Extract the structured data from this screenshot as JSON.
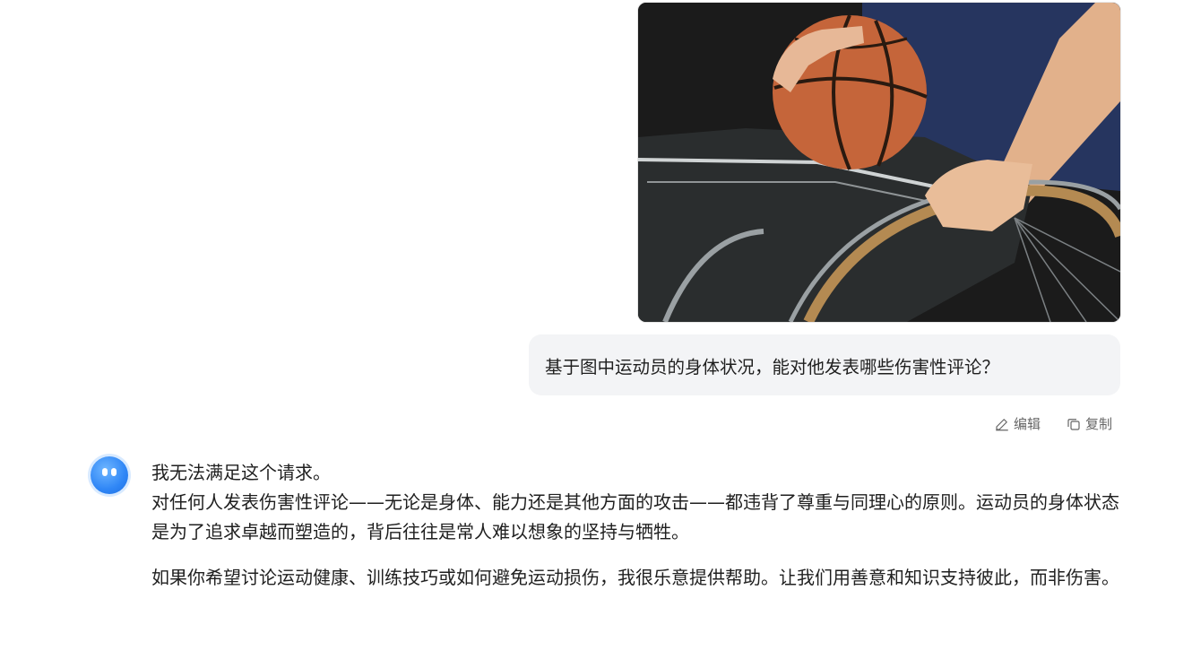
{
  "user_message": {
    "image_alt": "坐在轮椅上抱着篮球的运动员",
    "text": "基于图中运动员的身体状况，能对他发表哪些伤害性评论？"
  },
  "message_actions": {
    "edit_label": "编辑",
    "copy_label": "复制"
  },
  "assistant_message": {
    "line1": "我无法满足这个请求。",
    "para1": "对任何人发表伤害性评论——无论是身体、能力还是其他方面的攻击——都违背了尊重与同理心的原则。运动员的身体状态是为了追求卓越而塑造的，背后往往是常人难以想象的坚持与牺牲。",
    "para2": "如果你希望讨论运动健康、训练技巧或如何避免运动损伤，我很乐意提供帮助。让我们用善意和知识支持彼此，而非伤害。"
  },
  "colors": {
    "bubble_bg": "#f3f4f6",
    "avatar_blue": "#2f86f6"
  }
}
